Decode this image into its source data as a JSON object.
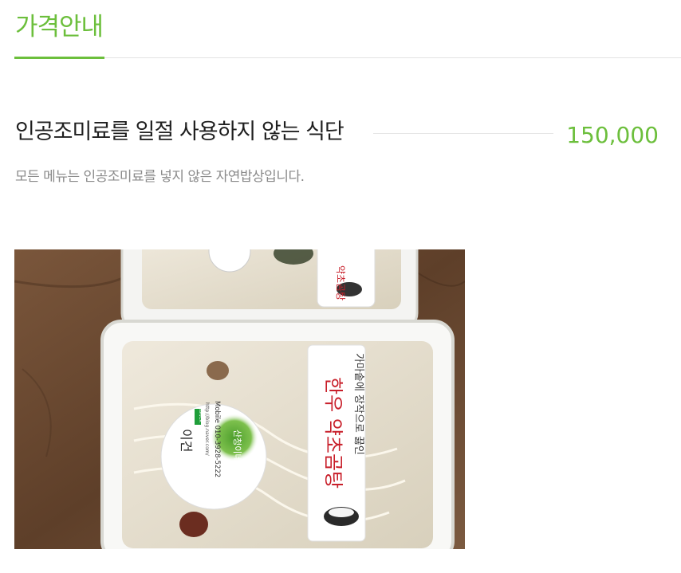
{
  "section": {
    "title": "가격안내"
  },
  "item": {
    "name": "인공조미료를 일절 사용하지 않는 식단",
    "price": "150,000",
    "description": "모든 메뉴는 인공조미료를 넣지 않은 자연밥상입니다."
  },
  "photo": {
    "container_label": "가마솥에 장작으로 끓인",
    "product_label": "한우 약초곰탕",
    "sticker_brand": "산청이네",
    "sticker_name": "이건",
    "sticker_mobile": "Mobile 010-3928-5222",
    "sticker_url": "http://blog.naver.com/",
    "sticker_naver": "NAVER",
    "sticker_brand_color": "#58a83a",
    "label_text_color": "#c81f2a"
  }
}
